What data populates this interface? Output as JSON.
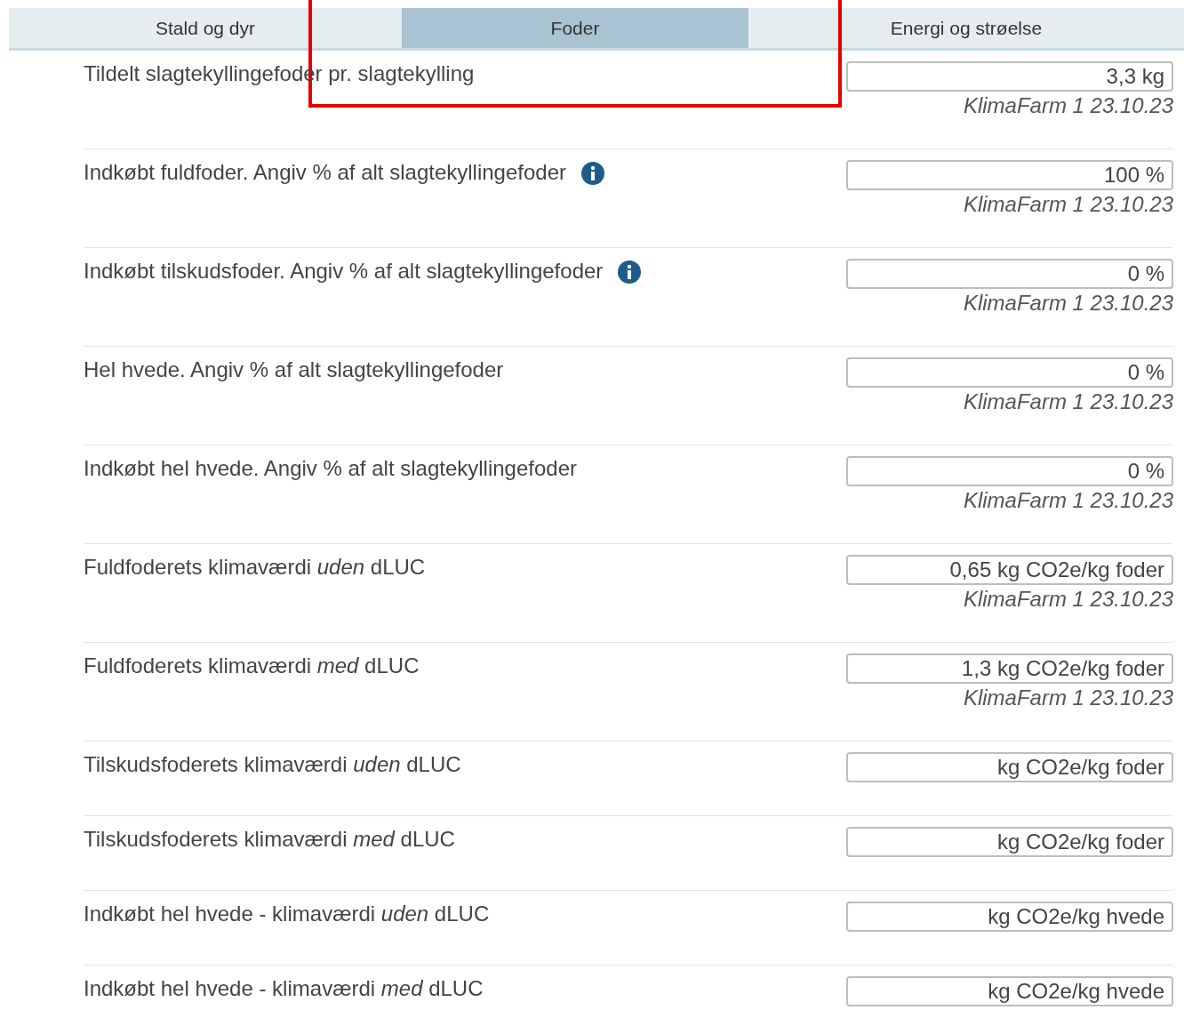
{
  "tabs": [
    {
      "label": "Stald og dyr",
      "selected": false
    },
    {
      "label": "Foder",
      "selected": true
    },
    {
      "label": "Energi og strøelse",
      "selected": false
    }
  ],
  "rows": [
    {
      "label": "Tildelt slagtekyllingefoder pr. slagtekylling",
      "info": false,
      "value": "3,3 kg",
      "source": "KlimaFarm 1 23.10.23"
    },
    {
      "label": "Indkøbt fuldfoder. Angiv % af alt slagtekyllingefoder",
      "info": true,
      "value": "100 %",
      "source": "KlimaFarm 1 23.10.23"
    },
    {
      "label": "Indkøbt tilskudsfoder. Angiv % af alt slagtekyllingefoder",
      "info": true,
      "value": "0 %",
      "source": "KlimaFarm 1 23.10.23"
    },
    {
      "label": "Hel hvede. Angiv % af alt slagtekyllingefoder",
      "info": false,
      "value": "0 %",
      "source": "KlimaFarm 1 23.10.23"
    },
    {
      "label": "Indkøbt hel hvede. Angiv % af alt slagtekyllingefoder",
      "info": false,
      "value": "0 %",
      "source": "KlimaFarm 1 23.10.23"
    },
    {
      "label": "Fuldfoderets klimaværdi *uden* dLUC",
      "info": false,
      "value": "0,65 kg CO2e/kg foder",
      "source": "KlimaFarm 1 23.10.23"
    },
    {
      "label": "Fuldfoderets klimaværdi *med* dLUC",
      "info": false,
      "value": "1,3 kg CO2e/kg foder",
      "source": "KlimaFarm 1 23.10.23"
    },
    {
      "label": "Tilskudsfoderets klimaværdi *uden* dLUC",
      "info": false,
      "value": "kg CO2e/kg foder"
    },
    {
      "label": "Tilskudsfoderets klimaværdi *med* dLUC",
      "info": false,
      "value": "kg CO2e/kg foder"
    },
    {
      "label": "Indkøbt hel hvede - klimaværdi *uden* dLUC",
      "info": false,
      "value": "kg CO2e/kg hvede"
    },
    {
      "label": "Indkøbt hel hvede - klimaværdi *med* dLUC",
      "info": false,
      "value": "kg CO2e/kg hvede"
    }
  ],
  "annotation": {
    "kind": "frame"
  }
}
